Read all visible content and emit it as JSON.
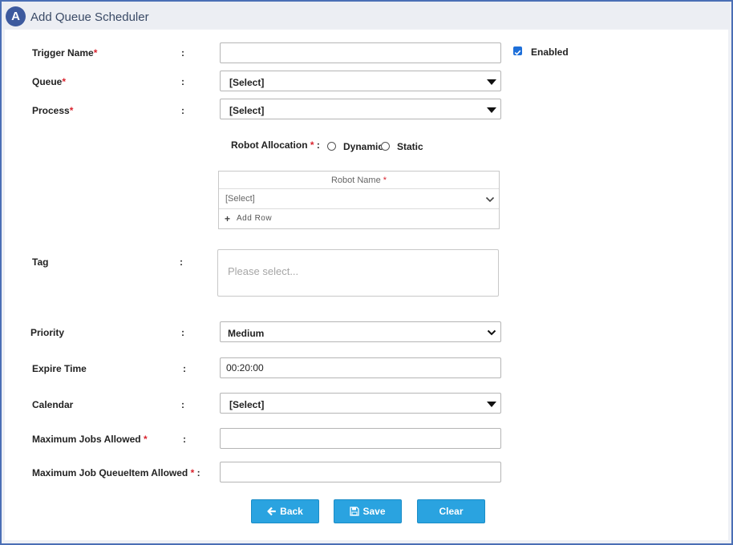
{
  "header": {
    "logo_letter": "A",
    "title": "Add Queue Scheduler"
  },
  "form": {
    "trigger_name": {
      "label": "Trigger Name",
      "required_mark": "*",
      "colon": ":",
      "value": ""
    },
    "enabled": {
      "label": "Enabled",
      "checked": true
    },
    "queue": {
      "label": "Queue",
      "required_mark": "*",
      "colon": ":",
      "value": "[Select]"
    },
    "process": {
      "label": "Process",
      "required_mark": "*",
      "colon": ":",
      "value": "[Select]"
    },
    "robot_allocation": {
      "label": "Robot Allocation",
      "required_mark": "*",
      "colon": ":",
      "options": [
        "Dynamic",
        "Static"
      ]
    },
    "robot_grid": {
      "column_header": "Robot Name",
      "required_mark": "*",
      "row_value": "[Select]",
      "add_row_icon": "plus-icon",
      "add_row_label": "Add Row"
    },
    "tag": {
      "label": "Tag",
      "colon": ":",
      "placeholder": "Please select..."
    },
    "priority": {
      "label": "Priority",
      "colon": ":",
      "value": "Medium"
    },
    "expire_time": {
      "label": "Expire Time",
      "colon": ":",
      "value": "00:20:00"
    },
    "calendar": {
      "label": "Calendar",
      "colon": ":",
      "value": "[Select]"
    },
    "max_jobs": {
      "label": "Maximum Jobs Allowed",
      "required_mark": "*",
      "colon": ":",
      "value": ""
    },
    "max_queueitem": {
      "label": "Maximum Job QueueItem Allowed",
      "required_mark": "*",
      "colon": ":",
      "value": ""
    }
  },
  "buttons": {
    "back": {
      "label": "Back",
      "icon": "arrow-left-icon"
    },
    "save": {
      "label": "Save",
      "icon": "floppy-disk-icon"
    },
    "clear": {
      "label": "Clear"
    }
  },
  "colors": {
    "accent": "#2aa3e0",
    "frame_border": "#4a6fb5",
    "logo_bg": "#3d5a9e",
    "required": "#d9232e",
    "checkbox": "#1e6fd9"
  }
}
